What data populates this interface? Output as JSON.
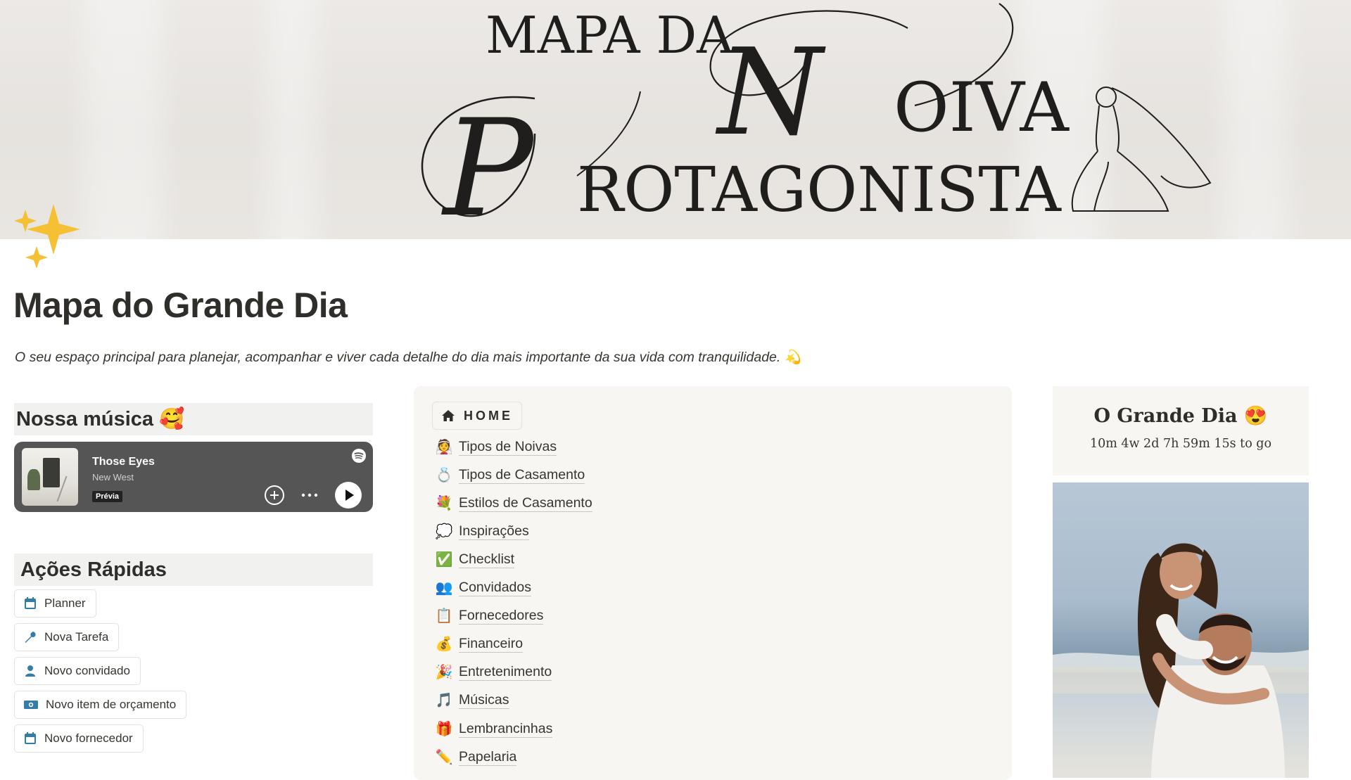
{
  "cover": {
    "line1": "MAPA DA",
    "line2_initial": "N",
    "line2_rest": "OIVA",
    "line3_initial": "P",
    "line3_rest": "ROTAGONISTA"
  },
  "page": {
    "icon": "sparkles-icon",
    "title": "Mapa do Grande Dia",
    "description": "O seu espaço principal para planejar, acompanhar e viver cada detalhe do dia mais importante da sua vida com tranquilidade. 💫"
  },
  "music": {
    "heading": "Nossa música 🥰",
    "player": {
      "track": "Those Eyes",
      "artist": "New West",
      "badge": "Prévia",
      "icons": [
        "spotify-icon",
        "add-circle-icon",
        "more-icon",
        "play-icon"
      ]
    }
  },
  "quick_actions": {
    "heading": "Ações Rápidas",
    "items": [
      {
        "label": "Planner",
        "icon": "calendar-icon"
      },
      {
        "label": "Nova Tarefa",
        "icon": "wrench-icon"
      },
      {
        "label": "Novo convidado",
        "icon": "person-icon"
      },
      {
        "label": "Novo item de orçamento",
        "icon": "money-icon"
      },
      {
        "label": "Novo fornecedor",
        "icon": "calendar-icon"
      }
    ]
  },
  "nav": {
    "home_label": "HOME",
    "links": [
      {
        "label": "Tipos de Noivas",
        "emoji": "👰"
      },
      {
        "label": "Tipos de Casamento",
        "emoji": "💍"
      },
      {
        "label": "Estilos de Casamento",
        "emoji": "💐"
      },
      {
        "label": "Inspirações",
        "emoji": "💭"
      },
      {
        "label": "Checklist",
        "emoji": "✅"
      },
      {
        "label": "Convidados",
        "emoji": "👥"
      },
      {
        "label": "Fornecedores",
        "emoji": "📋"
      },
      {
        "label": "Financeiro",
        "emoji": "💰"
      },
      {
        "label": "Entretenimento",
        "emoji": "🎉"
      },
      {
        "label": "Músicas",
        "emoji": "🎵"
      },
      {
        "label": "Lembrancinhas",
        "emoji": "🎁"
      },
      {
        "label": "Papelaria",
        "emoji": "✏️"
      }
    ]
  },
  "countdown": {
    "title": "O Grande Dia 😍",
    "value": "10m 4w 2d 7h 59m 15s to go"
  },
  "colors": {
    "text": "#37352f",
    "panel_bg": "#f7f6f3",
    "heading_bg": "#f1f1ef",
    "player_bg": "#555555",
    "action_icon": "#337ea9"
  }
}
